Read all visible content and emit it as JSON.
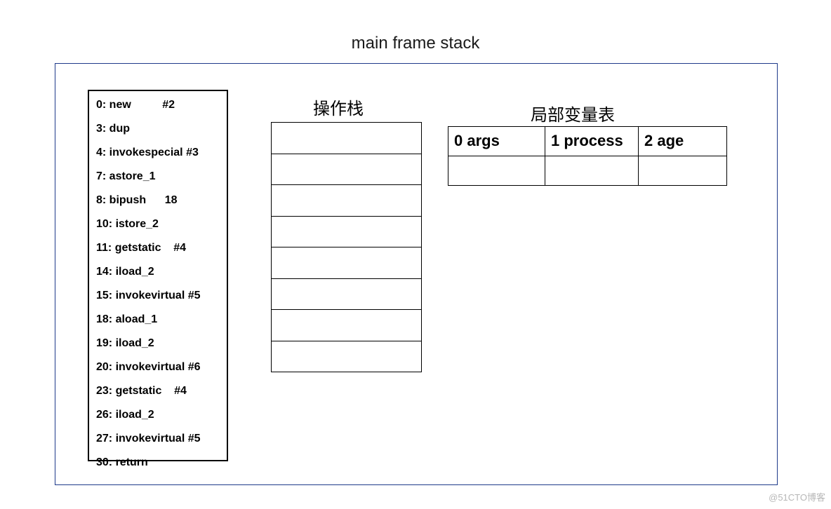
{
  "title": "main frame stack",
  "bytecode": {
    "lines": [
      "0: new          #2",
      "3: dup",
      "4: invokespecial #3",
      "7: astore_1",
      "8: bipush      18",
      "10: istore_2",
      "11: getstatic    #4",
      "14: iload_2",
      "15: invokevirtual #5",
      "18: aload_1",
      "19: iload_2",
      "20: invokevirtual #6",
      "23: getstatic    #4",
      "26: iload_2",
      "27: invokevirtual #5",
      "30: return"
    ]
  },
  "operand_stack": {
    "title": "操作栈",
    "rows": [
      "",
      "",
      "",
      "",
      "",
      "",
      "",
      ""
    ]
  },
  "local_var_table": {
    "title": "局部变量表",
    "headers": [
      "0 args",
      "1 process",
      "2 age"
    ],
    "values": [
      "",
      "",
      ""
    ]
  },
  "watermark": "@51CTO博客"
}
